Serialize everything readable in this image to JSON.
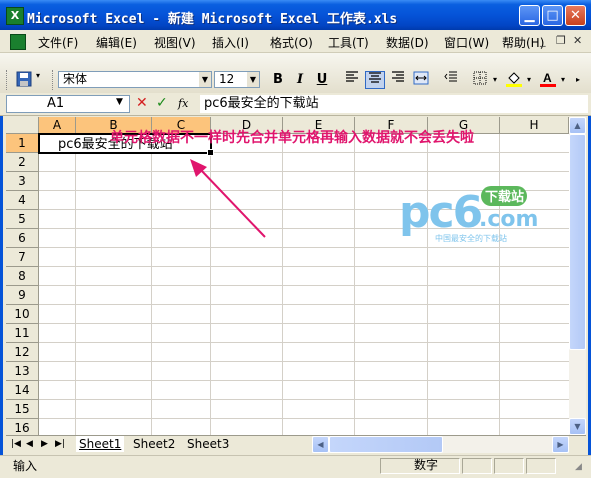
{
  "window": {
    "title": "Microsoft Excel - 新建 Microsoft Excel 工作表.xls",
    "icon_letter": "X"
  },
  "menu": {
    "items": [
      {
        "label": "文件(F)"
      },
      {
        "label": "编辑(E)"
      },
      {
        "label": "视图(V)"
      },
      {
        "label": "插入(I)"
      },
      {
        "label": "格式(O)"
      },
      {
        "label": "工具(T)"
      },
      {
        "label": "数据(D)"
      },
      {
        "label": "窗口(W)"
      },
      {
        "label": "帮助(H)"
      }
    ]
  },
  "toolbar": {
    "font_name": "宋体",
    "font_size": "12",
    "bold": "B",
    "italic": "I",
    "underline": "U"
  },
  "formula_bar": {
    "name_box": "A1",
    "cancel": "✕",
    "enter": "✓",
    "fx": "fx",
    "content": "pc6最安全的下载站"
  },
  "grid": {
    "columns": [
      "A",
      "B",
      "C",
      "D",
      "E",
      "F",
      "G",
      "H"
    ],
    "rows": [
      "1",
      "2",
      "3",
      "4",
      "5",
      "6",
      "7",
      "8",
      "9",
      "10",
      "11",
      "12",
      "13",
      "14",
      "15",
      "16"
    ],
    "cell_a1": "pc6最安全的下载站"
  },
  "annotation": "单元格数据不一样时先合并单元格再输入数据就不会丢失啦",
  "watermark": {
    "brand": "pc6",
    "tag": "下载站",
    "domain": ".com",
    "slogan": "中国最安全的下载站"
  },
  "sheets": [
    {
      "label": "Sheet1"
    },
    {
      "label": "Sheet2"
    },
    {
      "label": "Sheet3"
    }
  ],
  "status": {
    "mode": "输入",
    "indicator": "数字"
  }
}
